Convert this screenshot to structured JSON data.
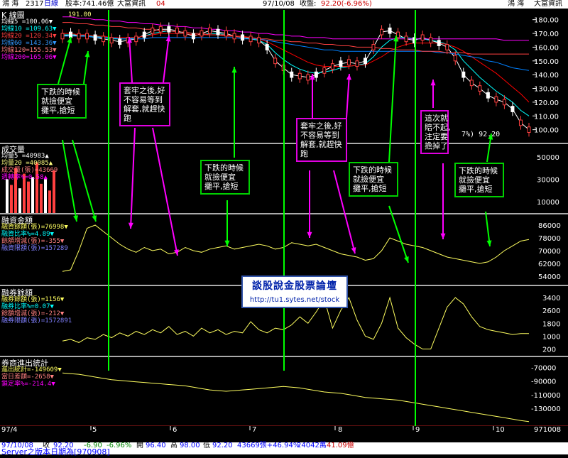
{
  "header": {
    "stock_name": "鴻 海",
    "code": "2317",
    "period": "日線",
    "capital": "股本:741.46億",
    "source": "大富資訊",
    "num": "04",
    "date": "97/10/08",
    "close_label": "收盤:",
    "close_value": "92.20(-6.96%)",
    "right_name": "鴻 海",
    "right_source": "大富資訊"
  },
  "panels": {
    "kline": {
      "title": "K 線圖",
      "max_tag": "191.00",
      "legend": [
        "均線5 =100.06▼",
        "均線10 =109.63▼",
        "均線20 =120.34▼",
        "均線60 =143.36▼",
        "均線120=155.53▼",
        "均線200=165.06▼"
      ],
      "y_ticks": [
        "180.00",
        "170.00",
        "160.00",
        "150.00",
        "140.00",
        "130.00",
        "120.00",
        "110.00",
        "100.00"
      ],
      "last_tag": "7%) 92.20"
    },
    "volume": {
      "title": "成交量",
      "legend": [
        "均量5 =40983▲",
        "均量20 =40085▲",
        "成交量(張)=43669",
        "週轉率%=0.58▲"
      ],
      "y_ticks": [
        "50000",
        "30000",
        "10000"
      ]
    },
    "margin": {
      "title": "融資金額",
      "legend": [
        "融資餘額(張)=76998▼",
        "融資比率%=4.89▼",
        "餘額增減(張)=-355▼",
        "融資限額(張)=157289"
      ],
      "y_ticks": [
        "86000",
        "78000",
        "70000",
        "62000",
        "54000"
      ]
    },
    "short": {
      "title": "融券餘額",
      "legend": [
        "融券餘額(張)=1156▼",
        "融券比率%=0.07▼",
        "餘額增減(張)=-212▼",
        "融券限額(張)=1572891"
      ],
      "y_ticks": [
        "3400",
        "2600",
        "1800",
        "1000",
        "200"
      ]
    },
    "broker": {
      "title": "券商進出統計",
      "legend": [
        "進出統計=-149609▼",
        "當日差額=-2658▼",
        "鎖定率%=-214.4▼"
      ],
      "y_ticks": [
        "-70000",
        "-90000",
        "-110000",
        "-130000"
      ]
    }
  },
  "notes": [
    {
      "id": "n1",
      "color": "green",
      "text": "下跌的時候\n就撿便宜\n攤平,搶短"
    },
    {
      "id": "n2",
      "color": "magenta",
      "text": "套牢之後,好\n不容易等到\n解套,就趕快\n跑"
    },
    {
      "id": "n3",
      "color": "green",
      "text": "下跌的時候\n就撿便宜\n攤平,搶短"
    },
    {
      "id": "n4",
      "color": "magenta",
      "text": "套牢之後,好\n不容易等到\n解套,就趕快\n跑"
    },
    {
      "id": "n5",
      "color": "green",
      "text": "下跌的時候\n就撿便宜\n攤平,搶短"
    },
    {
      "id": "n6",
      "color": "magenta",
      "text": "這次就\n賠不起,\n注定要\n擔掉了"
    },
    {
      "id": "n7",
      "color": "green",
      "text": "下跌的時候\n就撿便宜\n攤平,搶短"
    }
  ],
  "watermark": {
    "title": "談股說金股票論壇",
    "url": "http://tu1.sytes.net/stock"
  },
  "x_axis": {
    "labels": [
      "97/4",
      "5",
      "6",
      "7",
      "8",
      "9",
      "10"
    ],
    "end_date": "971008"
  },
  "status": {
    "date": "97/10/08",
    "close_l": "收",
    "close": "92.20",
    "chg": "-6.90",
    "pct": "-6.96%",
    "open_l": "開",
    "open": "96.40",
    "high_l": "高",
    "high": "98.00",
    "low_l": "低",
    "low": "92.20",
    "vol": "43669張+46.94%",
    "amt": "24042萬",
    "last": "41.09億",
    "server": "Server之版本日期為[970908]"
  },
  "colors": {
    "ma5": "#ffffff",
    "ma10": "#00ffff",
    "ma20": "#ff0000",
    "ma60": "#0080ff",
    "ma120": "#ff4040",
    "ma200": "#ff00ff",
    "up": "#ff4040",
    "down": "#ffffff",
    "margin_line": "#ffff60",
    "grid": "#b0b0b0"
  },
  "chart_data": {
    "type": "line",
    "series": [
      {
        "name": "均線5",
        "values": [
          168,
          169,
          168,
          168,
          167,
          166,
          165,
          164,
          165,
          166,
          169,
          172,
          173,
          173,
          172,
          170,
          168,
          170,
          172,
          171,
          170,
          168,
          167,
          166,
          165,
          160,
          150,
          145,
          140,
          139,
          138,
          140,
          143,
          146,
          148,
          149,
          148,
          150,
          160,
          171,
          172,
          169,
          166,
          165,
          167,
          165,
          163,
          160,
          152,
          140,
          134,
          130,
          125,
          122,
          120,
          115,
          105,
          100
        ]
      },
      {
        "name": "均線10",
        "values": [
          169,
          169,
          169,
          168,
          168,
          167,
          166,
          166,
          166,
          167,
          168,
          170,
          171,
          172,
          171,
          170,
          169,
          169,
          170,
          170,
          169,
          168,
          167,
          166,
          165,
          162,
          156,
          151,
          147,
          144,
          142,
          141,
          142,
          143,
          145,
          146,
          147,
          148,
          153,
          160,
          165,
          167,
          167,
          166,
          166,
          165,
          164,
          162,
          158,
          150,
          144,
          138,
          133,
          128,
          124,
          120,
          114,
          110
        ]
      },
      {
        "name": "均線20",
        "values": [
          170,
          170,
          169,
          169,
          168,
          168,
          167,
          167,
          167,
          167,
          168,
          169,
          170,
          170,
          170,
          170,
          169,
          169,
          169,
          169,
          169,
          168,
          168,
          167,
          166,
          164,
          161,
          158,
          155,
          152,
          149,
          147,
          146,
          146,
          146,
          146,
          147,
          147,
          150,
          153,
          157,
          160,
          162,
          163,
          163,
          163,
          163,
          162,
          160,
          157,
          153,
          149,
          145,
          141,
          136,
          131,
          126,
          120
        ]
      },
      {
        "name": "均線60",
        "values": [
          168,
          168,
          168,
          168,
          167,
          167,
          167,
          166,
          166,
          166,
          166,
          167,
          167,
          167,
          167,
          167,
          167,
          167,
          167,
          167,
          167,
          167,
          166,
          166,
          166,
          165,
          164,
          163,
          162,
          161,
          160,
          159,
          158,
          158,
          157,
          157,
          157,
          157,
          157,
          157,
          157,
          157,
          157,
          157,
          157,
          157,
          156,
          156,
          155,
          154,
          153,
          152,
          150,
          149,
          147,
          145,
          144,
          143
        ]
      },
      {
        "name": "均線120",
        "values": [
          178,
          178,
          177,
          177,
          176,
          176,
          175,
          175,
          174,
          174,
          173,
          173,
          172,
          172,
          171,
          171,
          170,
          170,
          169,
          169,
          168,
          168,
          167,
          167,
          166,
          166,
          165,
          165,
          164,
          164,
          163,
          163,
          162,
          162,
          161,
          161,
          160,
          160,
          160,
          159,
          159,
          158,
          158,
          158,
          157,
          157,
          157,
          156,
          156,
          156,
          155,
          155,
          155,
          155,
          155,
          155,
          155,
          155
        ]
      },
      {
        "name": "均線200",
        "values": [
          182,
          182,
          181,
          181,
          180,
          180,
          179,
          179,
          178,
          178,
          177,
          177,
          176,
          176,
          175,
          175,
          174,
          174,
          173,
          173,
          172,
          172,
          171,
          171,
          170,
          170,
          169,
          169,
          168,
          168,
          167,
          167,
          167,
          166,
          166,
          166,
          166,
          166,
          166,
          166,
          166,
          166,
          166,
          166,
          166,
          166,
          166,
          166,
          166,
          166,
          166,
          166,
          166,
          166,
          165,
          165,
          165,
          165
        ]
      },
      {
        "name": "融資餘額",
        "values": [
          57000,
          58000,
          70000,
          84000,
          86000,
          82000,
          78000,
          74000,
          71000,
          69000,
          72000,
          70000,
          71000,
          68000,
          69000,
          72000,
          70000,
          69000,
          71000,
          72000,
          73000,
          71000,
          72000,
          73000,
          74000,
          73000,
          71000,
          72000,
          75000,
          74000,
          73000,
          74000,
          72000,
          70000,
          68000,
          67000,
          66000,
          64000,
          65000,
          70000,
          78000,
          76000,
          74000,
          73000,
          72000,
          70000,
          68000,
          66000,
          65000,
          64000,
          63000,
          62000,
          63000,
          66000,
          70000,
          73000,
          76000,
          77000
        ]
      },
      {
        "name": "融券餘額",
        "values": [
          700,
          800,
          600,
          900,
          800,
          1100,
          900,
          1200,
          1000,
          1300,
          1100,
          1400,
          1200,
          1600,
          1100,
          1300,
          1000,
          1500,
          1200,
          1400,
          1100,
          1300,
          1200,
          1900,
          1400,
          1200,
          1500,
          1400,
          1700,
          2200,
          1800,
          2500,
          3300,
          1500,
          2600,
          3400,
          2000,
          1000,
          800,
          1800,
          3400,
          1500,
          900,
          500,
          200,
          200,
          1500,
          2800,
          3400,
          3000,
          2200,
          1600,
          1400,
          1300,
          1200,
          1100,
          1156,
          1156
        ]
      },
      {
        "name": "進出統計",
        "values": [
          -78000,
          -79000,
          -80000,
          -82000,
          -84000,
          -86000,
          -88000,
          -89000,
          -90000,
          -91000,
          -92000,
          -93000,
          -94000,
          -95000,
          -96000,
          -97000,
          -99000,
          -101000,
          -103000,
          -104000,
          -105000,
          -104000,
          -103000,
          -102000,
          -101000,
          -100000,
          -99000,
          -98000,
          -99000,
          -100000,
          -102000,
          -104000,
          -106000,
          -107000,
          -108000,
          -110000,
          -112000,
          -114000,
          -115000,
          -116000,
          -117000,
          -118000,
          -120000,
          -122000,
          -124000,
          -126000,
          -128000,
          -130000,
          -132000,
          -134000,
          -136000,
          -138000,
          -140000,
          -142000,
          -144000,
          -146000,
          -148000,
          -149609
        ]
      }
    ]
  }
}
